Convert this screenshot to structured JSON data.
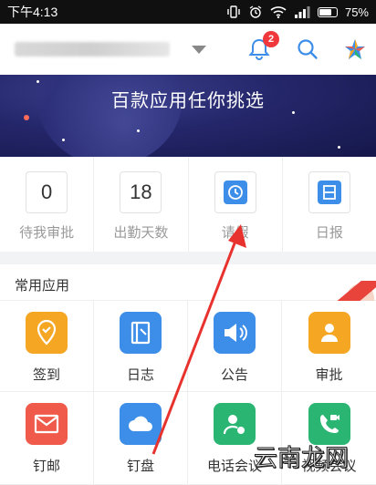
{
  "status": {
    "time": "下午4:13",
    "battery": "75%"
  },
  "header": {
    "notification_count": "2"
  },
  "banner": {
    "title": "百款应用任你挑选"
  },
  "stats": [
    {
      "value": "0",
      "label": "待我审批"
    },
    {
      "value": "18",
      "label": "出勤天数"
    },
    {
      "value": "",
      "label": "请假"
    },
    {
      "value": "",
      "label": "日报"
    }
  ],
  "section": {
    "title": "常用应用"
  },
  "apps": [
    {
      "label": "签到",
      "color": "#f5a623",
      "icon": "location-pin-icon"
    },
    {
      "label": "日志",
      "color": "#3d8ee8",
      "icon": "notebook-icon"
    },
    {
      "label": "公告",
      "color": "#3d8ee8",
      "icon": "megaphone-icon"
    },
    {
      "label": "审批",
      "color": "#f5a623",
      "icon": "approval-person-icon"
    },
    {
      "label": "钉邮",
      "color": "#ef5a4a",
      "icon": "mail-icon"
    },
    {
      "label": "钉盘",
      "color": "#3d8ee8",
      "icon": "cloud-icon"
    },
    {
      "label": "电话会议",
      "color": "#2bb573",
      "icon": "phone-person-icon"
    },
    {
      "label": "视频会议",
      "color": "#2bb573",
      "icon": "video-phone-icon"
    }
  ],
  "watermark": "云南龙网",
  "colors": {
    "accent": "#3d8ee8",
    "badge": "#f0373c",
    "arrow": "#e8322e"
  }
}
